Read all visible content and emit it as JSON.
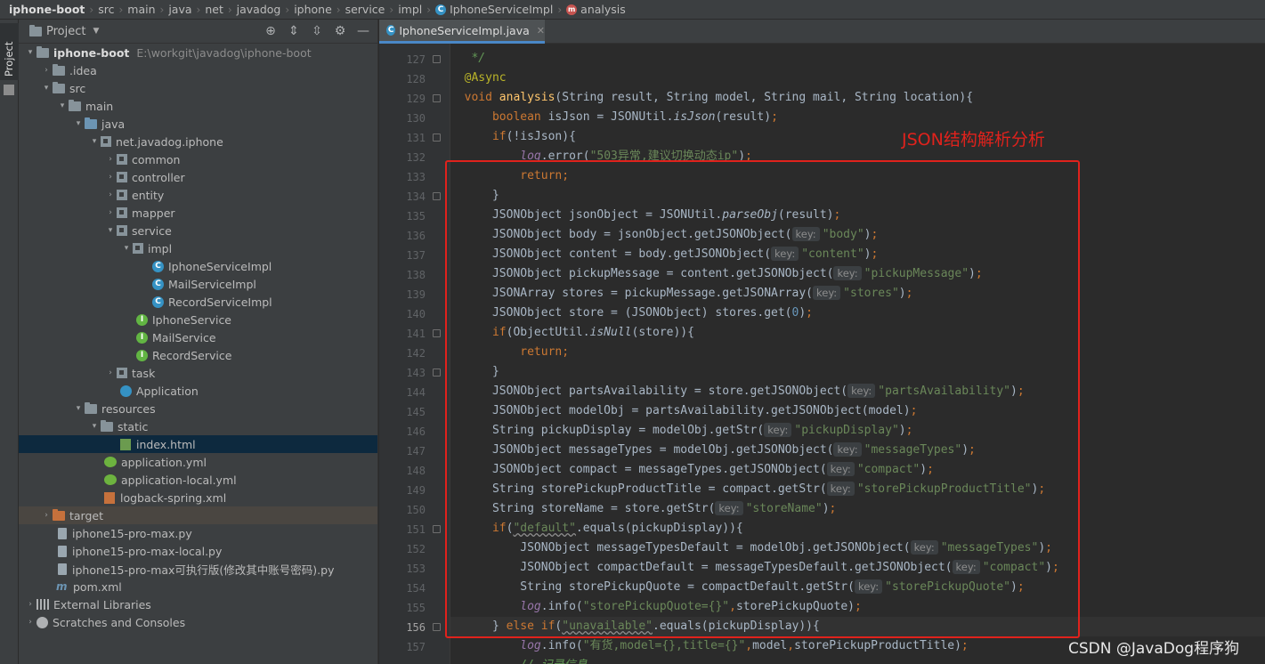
{
  "breadcrumb": [
    "iphone-boot",
    "src",
    "main",
    "java",
    "net",
    "javadog",
    "iphone",
    "service",
    "impl",
    "IphoneServiceImpl",
    "analysis"
  ],
  "stripe": {
    "label": "Project"
  },
  "project_panel": {
    "title": "Project",
    "tree": [
      {
        "label": "iphone-boot",
        "path": "E:\\workgit\\javadog\\iphone-boot"
      },
      {
        "label": ".idea"
      },
      {
        "label": "src"
      },
      {
        "label": "main"
      },
      {
        "label": "java"
      },
      {
        "label": "net.javadog.iphone"
      },
      {
        "label": "common"
      },
      {
        "label": "controller"
      },
      {
        "label": "entity"
      },
      {
        "label": "mapper"
      },
      {
        "label": "service"
      },
      {
        "label": "impl"
      },
      {
        "label": "IphoneServiceImpl"
      },
      {
        "label": "MailServiceImpl"
      },
      {
        "label": "RecordServiceImpl"
      },
      {
        "label": "IphoneService"
      },
      {
        "label": "MailService"
      },
      {
        "label": "RecordService"
      },
      {
        "label": "task"
      },
      {
        "label": "Application"
      },
      {
        "label": "resources"
      },
      {
        "label": "static"
      },
      {
        "label": "index.html"
      },
      {
        "label": "application.yml"
      },
      {
        "label": "application-local.yml"
      },
      {
        "label": "logback-spring.xml"
      },
      {
        "label": "target"
      },
      {
        "label": "iphone15-pro-max.py"
      },
      {
        "label": "iphone15-pro-max-local.py"
      },
      {
        "label": "iphone15-pro-max可执行版(修改其中账号密码).py"
      },
      {
        "label": "pom.xml"
      },
      {
        "label": "External Libraries"
      },
      {
        "label": "Scratches and Consoles"
      }
    ]
  },
  "editor": {
    "tab_label": "IphoneServiceImpl.java",
    "line_numbers": [
      "127",
      "128",
      "129",
      "130",
      "131",
      "132",
      "133",
      "134",
      "135",
      "136",
      "137",
      "138",
      "139",
      "140",
      "141",
      "142",
      "143",
      "144",
      "145",
      "146",
      "147",
      "148",
      "149",
      "150",
      "151",
      "152",
      "153",
      "154",
      "155",
      "156",
      "157"
    ],
    "current_line": "156"
  },
  "annotation": {
    "label": "JSON结构解析分析",
    "color": "#e0221c"
  },
  "watermark": "CSDN @JavaDog程序狗",
  "colors": {
    "keyword": "#cc7832",
    "string": "#6a8759",
    "method": "#ffc66d",
    "field": "#9876aa",
    "annotation": "#bbb529"
  }
}
